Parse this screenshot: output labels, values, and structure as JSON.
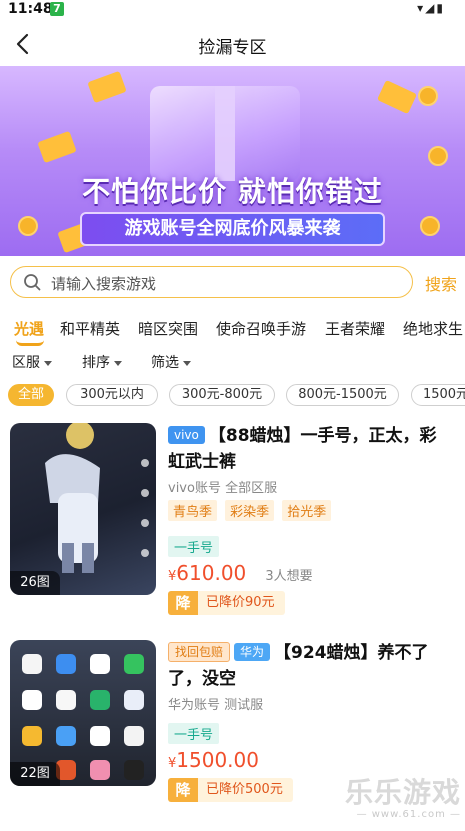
{
  "status_bar": {
    "time": "11:48",
    "app_badge": "7",
    "system_icons": "▾◢▮"
  },
  "header": {
    "back_icon": "‹",
    "title": "捡漏专区"
  },
  "banner": {
    "slogan": "不怕你比价 就怕你错过",
    "subtitle": "游戏账号全网底价风暴来袭"
  },
  "search": {
    "placeholder": "请输入搜索游戏",
    "button_label": "搜索"
  },
  "game_tabs": [
    {
      "label": "光遇",
      "active": true
    },
    {
      "label": "和平精英",
      "active": false
    },
    {
      "label": "暗区突围",
      "active": false
    },
    {
      "label": "使命召唤手游",
      "active": false
    },
    {
      "label": "王者荣耀",
      "active": false
    },
    {
      "label": "绝地求生",
      "active": false
    }
  ],
  "filters": [
    {
      "label": "区服"
    },
    {
      "label": "排序"
    },
    {
      "label": "筛选"
    }
  ],
  "price_chips": [
    {
      "label": "全部",
      "active": true
    },
    {
      "label": "300元以内",
      "active": false
    },
    {
      "label": "300元-800元",
      "active": false
    },
    {
      "label": "800元-1500元",
      "active": false
    },
    {
      "label": "1500元",
      "active": false
    }
  ],
  "listings": [
    {
      "image_count": "26图",
      "brand_tag": "vivo",
      "title": "【88蜡烛】一手号，正太，彩虹武士裤",
      "meta": "vivo账号  全部区服",
      "season_tags": [
        "青鸟季",
        "彩染季",
        "拾光季"
      ],
      "hand_tag": "一手号",
      "price_symbol": "¥",
      "price": "610.00",
      "wants": "3人想要",
      "drop_badge": "降",
      "drop_text": "已降价90元"
    },
    {
      "image_count": "22图",
      "extra_tag": "找回包赔",
      "brand_tag": "华为",
      "title": "【924蜡烛】养不了了，没空",
      "meta": "华为账号  测试服",
      "hand_tag": "一手号",
      "price_symbol": "¥",
      "price": "1500.00",
      "drop_badge": "降",
      "drop_text": "已降价500元"
    }
  ],
  "watermark": {
    "text": "乐乐游戏",
    "url": "— www.61.com —"
  },
  "colors": {
    "accent": "#f0a31a",
    "price": "#f04f2c",
    "banner": "#b68bf7"
  }
}
